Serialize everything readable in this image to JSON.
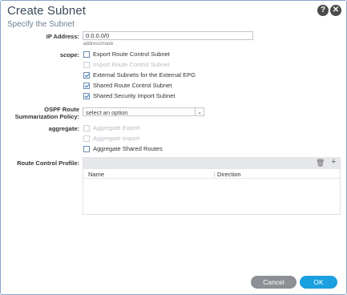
{
  "dialog": {
    "title": "Create Subnet",
    "subtitle": "Specify the Subnet",
    "help_symbol": "?",
    "close_symbol": "✕"
  },
  "ip": {
    "label": "IP Address:",
    "value": "0.0.0.0/0",
    "hint": "address/mask"
  },
  "scope": {
    "label": "scope:",
    "options": [
      {
        "label": "Export Route Control Subnet",
        "checked": false,
        "disabled": false
      },
      {
        "label": "Import Route Control Subnet",
        "checked": false,
        "disabled": true
      },
      {
        "label": "External Subnets for the External EPG",
        "checked": true,
        "disabled": false
      },
      {
        "label": "Shared Route Control Subnet",
        "checked": true,
        "disabled": false
      },
      {
        "label": "Shared Security Import Subnet",
        "checked": true,
        "disabled": false
      }
    ]
  },
  "ospf": {
    "label_line1": "OSPF Route",
    "label_line2": "Summarization Policy:",
    "value": "select an option"
  },
  "aggregate": {
    "label": "aggregate:",
    "options": [
      {
        "label": "Aggregate Export",
        "checked": false,
        "disabled": true
      },
      {
        "label": "Aggregate Import",
        "checked": false,
        "disabled": true
      },
      {
        "label": "Aggregate Shared Routes",
        "checked": false,
        "disabled": false
      }
    ]
  },
  "route_control": {
    "label": "Route Control Profile:",
    "columns": [
      "Name",
      "Direction"
    ],
    "delete_symbol": "🗑",
    "add_symbol": "+"
  },
  "footer": {
    "cancel_label": "Cancel",
    "ok_label": "OK"
  },
  "colors": {
    "ok": "#1aa0e0",
    "cancel": "#8c8f93",
    "frame": "#8aa7c9"
  }
}
